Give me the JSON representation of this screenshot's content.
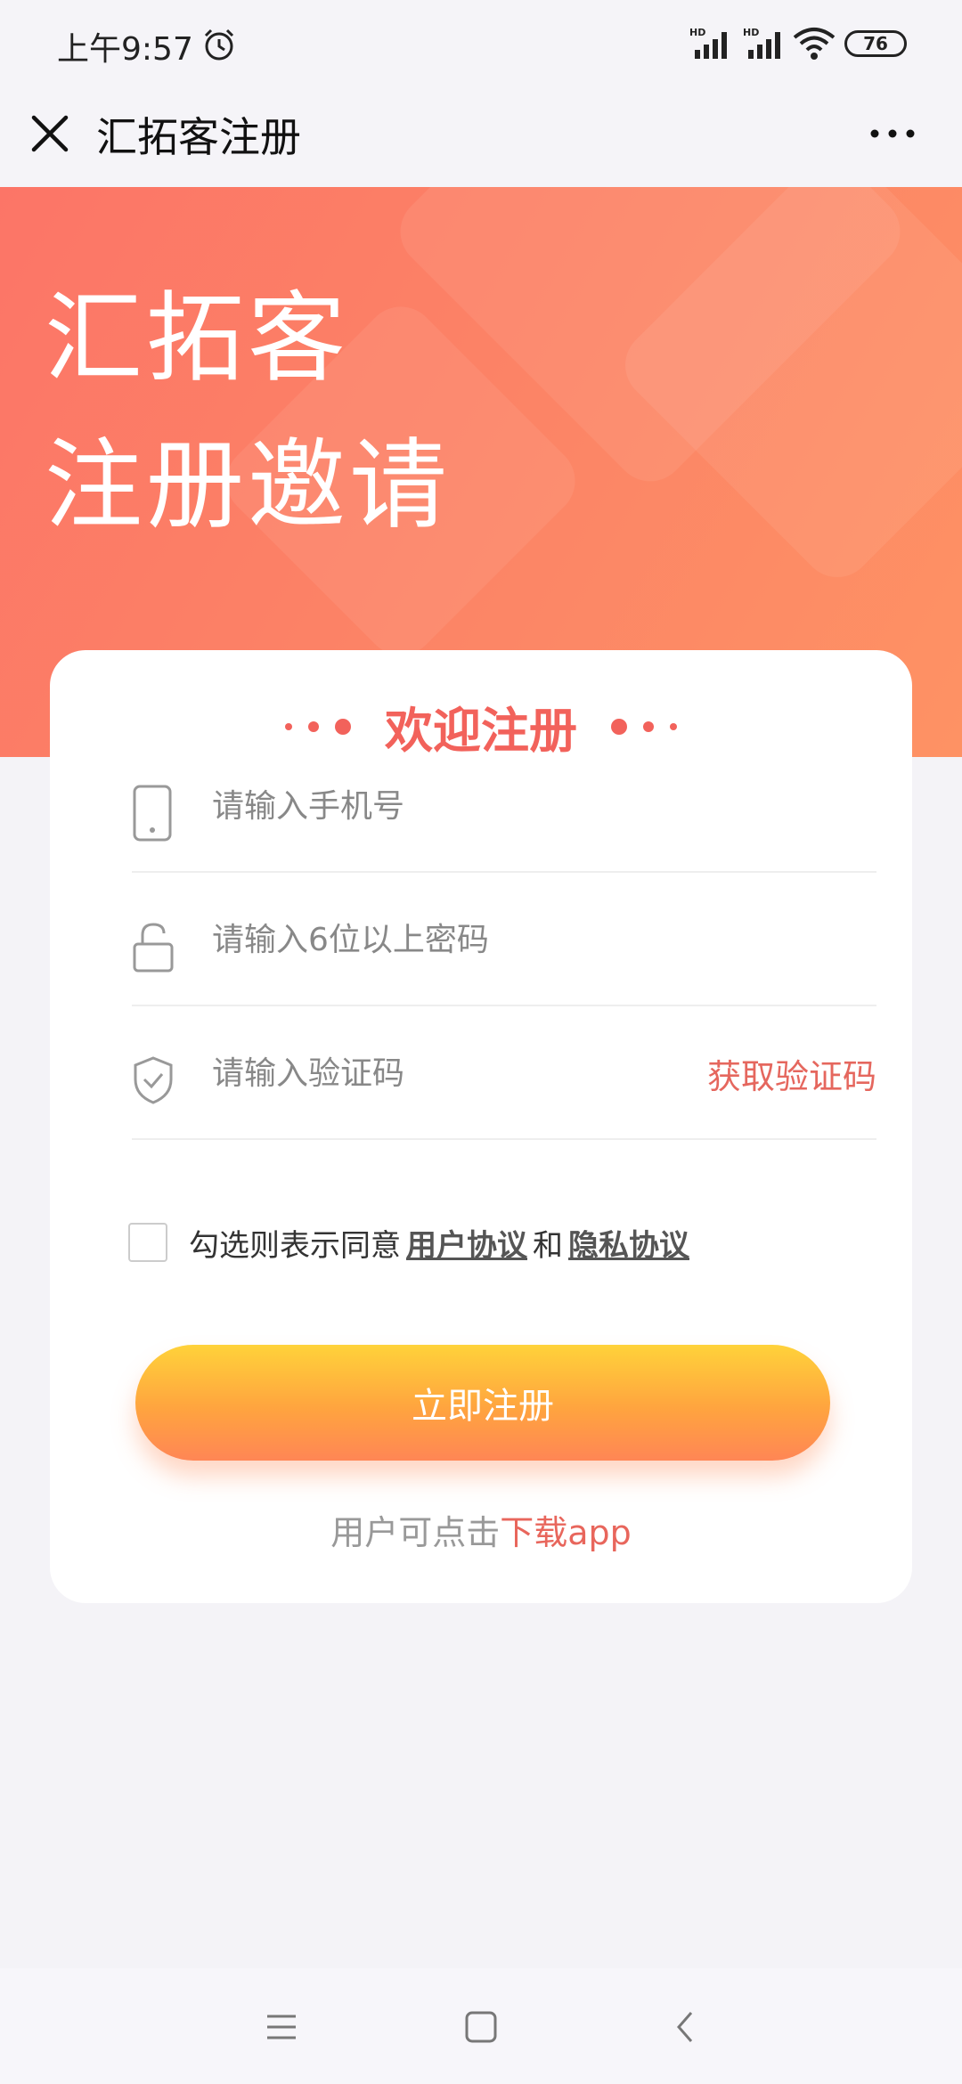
{
  "status_bar": {
    "time": "上午9:57",
    "signal_label_1": "HD",
    "signal_label_2": "HD",
    "battery": "76"
  },
  "nav": {
    "title": "汇拓客注册",
    "icons": {
      "close": "close-icon",
      "more": "more-icon"
    }
  },
  "hero": {
    "line1": "汇拓客",
    "line2": "注册邀请",
    "gradient": [
      "#fc7567",
      "#fe9264"
    ]
  },
  "card": {
    "heading": "欢迎注册",
    "fields": {
      "phone_placeholder": "请输入手机号",
      "password_placeholder": "请输入6位以上密码",
      "code_placeholder": "请输入验证码"
    },
    "get_code_label": "获取验证码",
    "agreement": {
      "prefix": "勾选则表示同意",
      "user_agreement": "用户协议",
      "conjunction": "和",
      "privacy_agreement": "隐私协议",
      "checked": false
    },
    "register_label": "立即注册",
    "download": {
      "prefix": "用户可点击",
      "link": "下载app"
    }
  },
  "colors": {
    "accent": "#f2625b",
    "link": "#e8665c",
    "button_top": "#ffd23a",
    "button_bottom": "#ff8655"
  }
}
